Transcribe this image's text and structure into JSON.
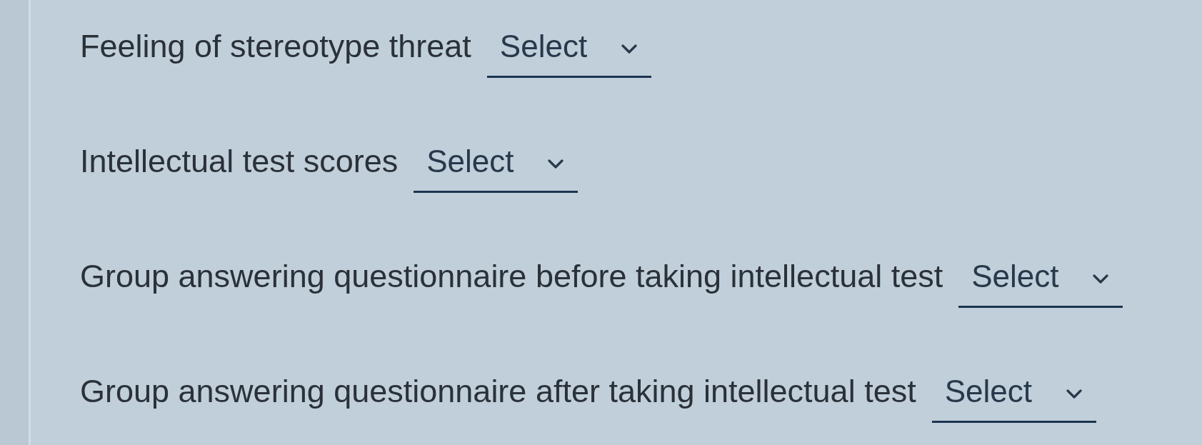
{
  "questions": [
    {
      "label": "Feeling of stereotype threat",
      "dropdown": {
        "value": "Select"
      }
    },
    {
      "label": "Intellectual test scores",
      "dropdown": {
        "value": "Select"
      }
    },
    {
      "label": "Group answering questionnaire before taking intellectual test",
      "dropdown": {
        "value": "Select"
      }
    },
    {
      "label": "Group answering questionnaire after taking intellectual test",
      "dropdown": {
        "value": "Select"
      }
    }
  ]
}
